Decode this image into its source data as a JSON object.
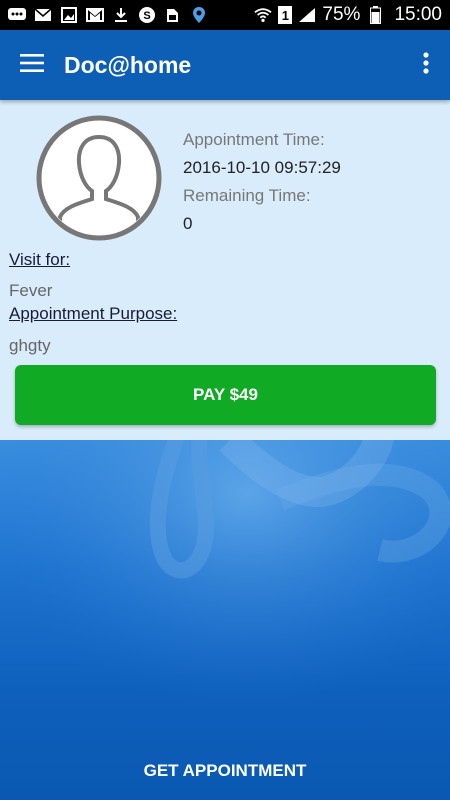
{
  "status_bar": {
    "icons": [
      "bbm-icon",
      "mail-icon",
      "image-icon",
      "gmail-icon",
      "download-icon",
      "skype-icon",
      "sd-card-icon",
      "location-icon",
      "wifi-icon",
      "sim-icon",
      "signal-icon",
      "battery-icon"
    ],
    "sim_label": "1",
    "battery": "75%",
    "time": "15:00"
  },
  "app_bar": {
    "title": "Doc@home"
  },
  "appointment": {
    "time_label": "Appointment Time:",
    "time_value": "2016-10-10 09:57:29",
    "remaining_label": "Remaining Time:",
    "remaining_value": "0",
    "visit_for_label": "Visit for:",
    "visit_for_value": "Fever",
    "purpose_label": "Appointment Purpose:",
    "purpose_value": "ghgty"
  },
  "actions": {
    "pay_label": "PAY $49",
    "get_appointment_label": "GET APPOINTMENT"
  },
  "colors": {
    "app_bar": "#0d5fb5",
    "panel": "#d9ecfb",
    "pay_button": "#11aa24"
  }
}
